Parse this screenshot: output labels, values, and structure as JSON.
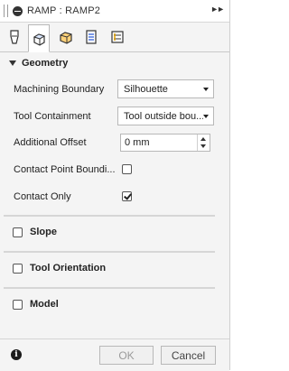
{
  "window": {
    "title": "RAMP : RAMP2"
  },
  "tabs": [
    {
      "icon": "tool-icon",
      "active": false
    },
    {
      "icon": "geometry-icon",
      "active": true
    },
    {
      "icon": "heights-icon",
      "active": false
    },
    {
      "icon": "passes-icon",
      "active": false
    },
    {
      "icon": "linking-icon",
      "active": false
    }
  ],
  "geometry": {
    "header": "Geometry",
    "machining_boundary": {
      "label": "Machining Boundary",
      "value": "Silhouette"
    },
    "tool_containment": {
      "label": "Tool Containment",
      "value": "Tool outside bou..."
    },
    "additional_offset": {
      "label": "Additional Offset",
      "value": "0 mm"
    },
    "contact_point_boundary": {
      "label": "Contact Point Boundi...",
      "checked": false
    },
    "contact_only": {
      "label": "Contact Only",
      "checked": true
    }
  },
  "sections": {
    "slope": {
      "label": "Slope",
      "checked": false
    },
    "tool_orientation": {
      "label": "Tool Orientation",
      "checked": false
    },
    "model": {
      "label": "Model",
      "checked": false
    }
  },
  "footer": {
    "ok_label": "OK",
    "cancel_label": "Cancel"
  }
}
